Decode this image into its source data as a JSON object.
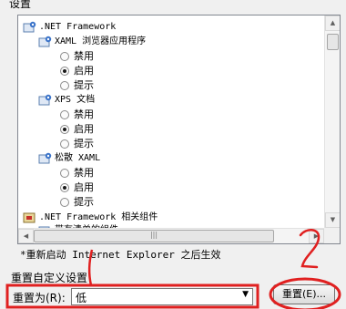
{
  "window": {
    "group_title": "设置"
  },
  "tree": {
    "root": {
      "label": ".NET Framework",
      "icon": "settings-folder-icon"
    },
    "groups": [
      {
        "label": "XAML 浏览器应用程序",
        "options": [
          "禁用",
          "启用",
          "提示"
        ],
        "selected": 1
      },
      {
        "label": "XPS 文档",
        "options": [
          "禁用",
          "启用",
          "提示"
        ],
        "selected": 1
      },
      {
        "label": "松散 XAML",
        "options": [
          "禁用",
          "启用",
          "提示"
        ],
        "selected": 1
      }
    ],
    "next_root": {
      "label": ".NET Framework 相关组件"
    },
    "partial_row": {
      "label": "带有清单的组件"
    }
  },
  "note": "*重新启动 Internet Explorer 之后生效",
  "reset_section": {
    "title": "重置自定义设置",
    "label": "重置为(R):",
    "selected_value": "低",
    "button_label": "重置(E)..."
  },
  "annotation": {
    "glyph": "2",
    "color": "#e02020"
  },
  "colors": {
    "annotation_red": "#e02020",
    "selection_box": "#e02020"
  }
}
